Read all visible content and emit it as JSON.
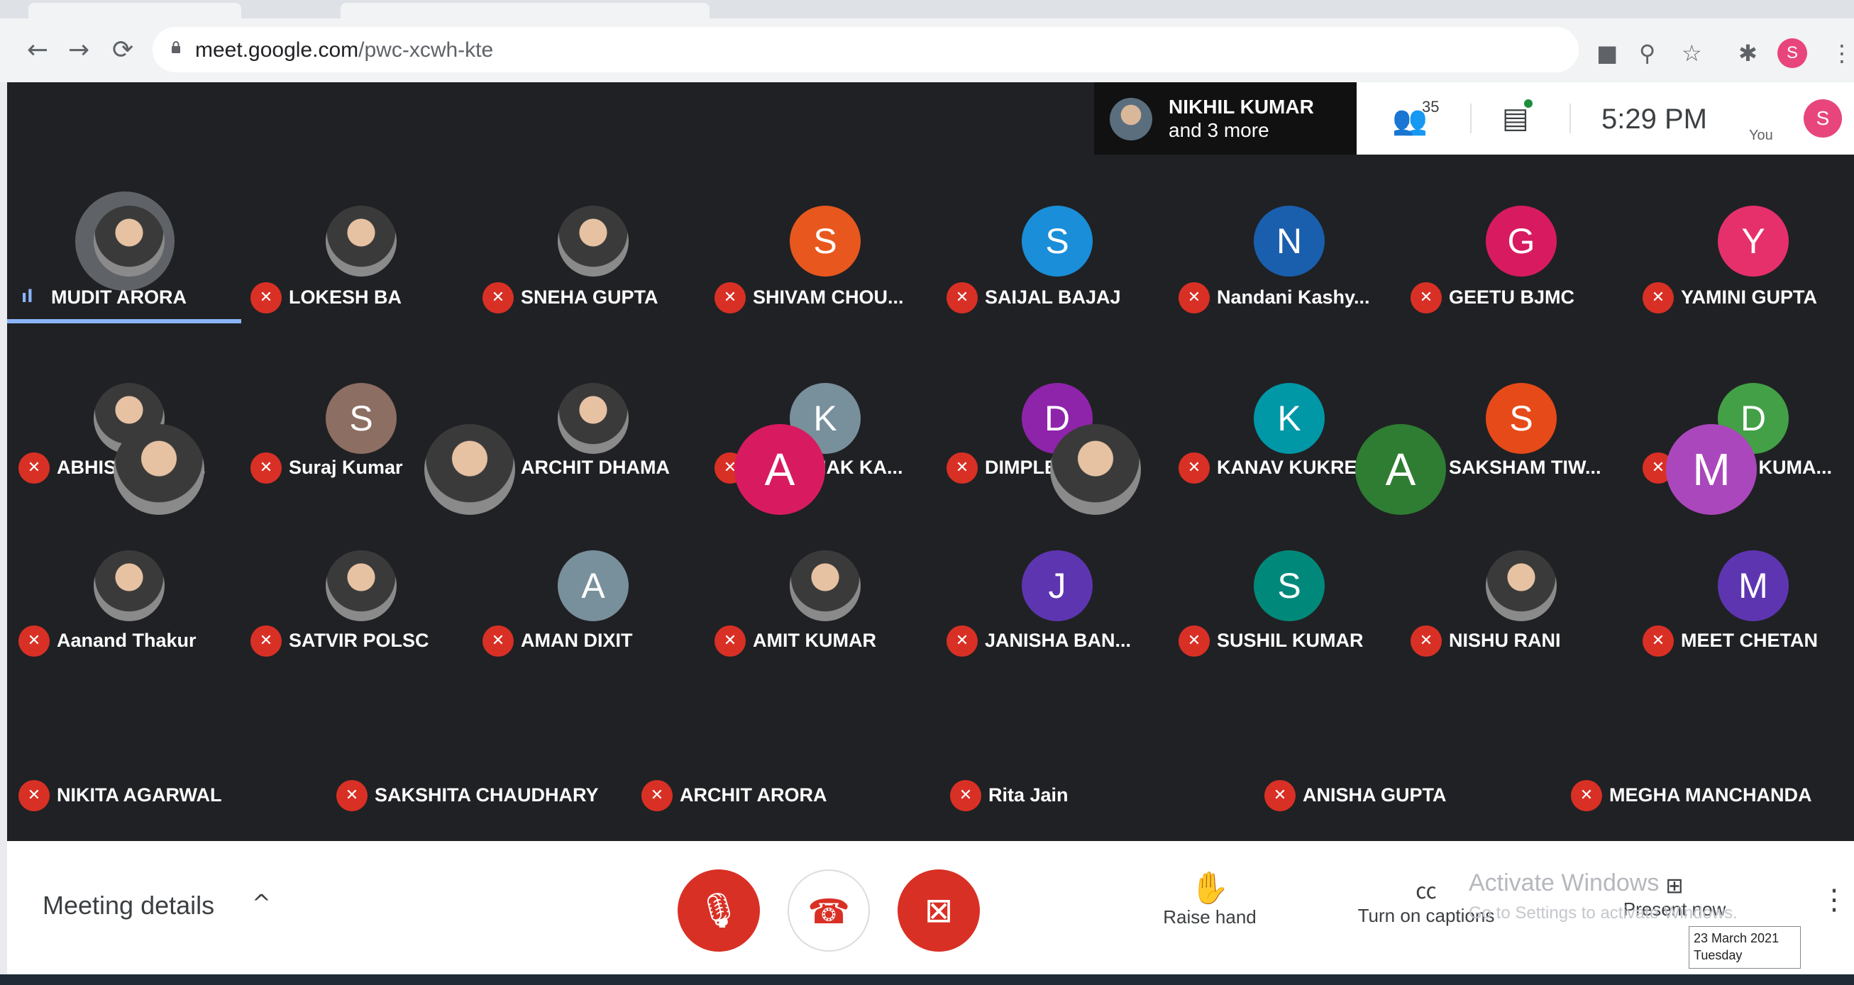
{
  "browser": {
    "url_host": "meet.google.com",
    "url_path": "/pwc-xcwh-kte",
    "profile_initial": "S"
  },
  "header": {
    "presenter_name": "NIKHIL KUMAR",
    "presenter_more": "and 3 more",
    "people_count": "35",
    "time": "5:29 PM",
    "you_label": "You",
    "you_initial": "S"
  },
  "participants": [
    {
      "name": "MUDIT ARORA",
      "initial": "",
      "color": "",
      "photo": true,
      "speaking": true
    },
    {
      "name": "LOKESH BA",
      "initial": "",
      "color": "",
      "photo": true
    },
    {
      "name": "SNEHA GUPTA",
      "initial": "",
      "color": "",
      "photo": true
    },
    {
      "name": "SHIVAM CHOU...",
      "initial": "S",
      "color": "#e8571e"
    },
    {
      "name": "SAIJAL BAJAJ",
      "initial": "S",
      "color": "#1a8ed8"
    },
    {
      "name": "Nandani Kashy...",
      "initial": "N",
      "color": "#1a5fae"
    },
    {
      "name": "GEETU BJMC",
      "initial": "G",
      "color": "#d81b60"
    },
    {
      "name": "YAMINI GUPTA",
      "initial": "Y",
      "color": "#e6306c"
    },
    {
      "name": "ABHISHEK KU...",
      "initial": "",
      "color": "",
      "photo": true
    },
    {
      "name": "Suraj Kumar",
      "initial": "S",
      "color": "#8d6e63"
    },
    {
      "name": "ARCHIT DHAMA",
      "initial": "",
      "color": "",
      "photo": true
    },
    {
      "name": "KANISHAK KA...",
      "initial": "K",
      "color": "#78909c"
    },
    {
      "name": "DIMPLE MALIK",
      "initial": "D",
      "color": "#8e24aa"
    },
    {
      "name": "KANAV KUKRE...",
      "initial": "K",
      "color": "#0097a7"
    },
    {
      "name": "SAKSHAM TIW...",
      "initial": "S",
      "color": "#e64a19"
    },
    {
      "name": "DIMPLE KUMA...",
      "initial": "D",
      "color": "#43a047"
    },
    {
      "name": "Aanand Thakur",
      "initial": "",
      "color": "",
      "photo": true
    },
    {
      "name": "SATVIR POLSC",
      "initial": "",
      "color": "",
      "photo": true
    },
    {
      "name": "AMAN DIXIT",
      "initial": "A",
      "color": "#78909c"
    },
    {
      "name": "AMIT KUMAR",
      "initial": "",
      "color": "",
      "photo": true
    },
    {
      "name": "JANISHA BAN...",
      "initial": "J",
      "color": "#5e35b1"
    },
    {
      "name": "SUSHIL KUMAR",
      "initial": "S",
      "color": "#00897b"
    },
    {
      "name": "NISHU RANI",
      "initial": "",
      "color": "",
      "photo": true
    },
    {
      "name": "MEET CHETAN",
      "initial": "M",
      "color": "#5e35b1"
    },
    {
      "name": "NIKITA AGARWAL",
      "initial": "",
      "color": "",
      "photo": true
    },
    {
      "name": "SAKSHITA CHAUDHARY",
      "initial": "",
      "color": "",
      "photo": true
    },
    {
      "name": "ARCHIT ARORA",
      "initial": "A",
      "color": "#d81b60"
    },
    {
      "name": "Rita Jain",
      "initial": "",
      "color": "",
      "photo": true
    },
    {
      "name": "ANISHA GUPTA",
      "initial": "A",
      "color": "#2e7d32"
    },
    {
      "name": "MEGHA MANCHANDA",
      "initial": "M",
      "color": "#ab47bc"
    }
  ],
  "bottom": {
    "meeting_details": "Meeting details",
    "raise_hand": "Raise hand",
    "captions": "Turn on captions",
    "present": "Present now",
    "activate_title": "Activate Windows",
    "activate_sub": "Go to Settings to activate Windows."
  },
  "taskbar": {
    "date": "23 March 2021",
    "day": "Tuesday"
  },
  "colors": {
    "accent_red": "#d93025",
    "meet_bg": "#202124",
    "speaking": "#8ab4f8"
  }
}
